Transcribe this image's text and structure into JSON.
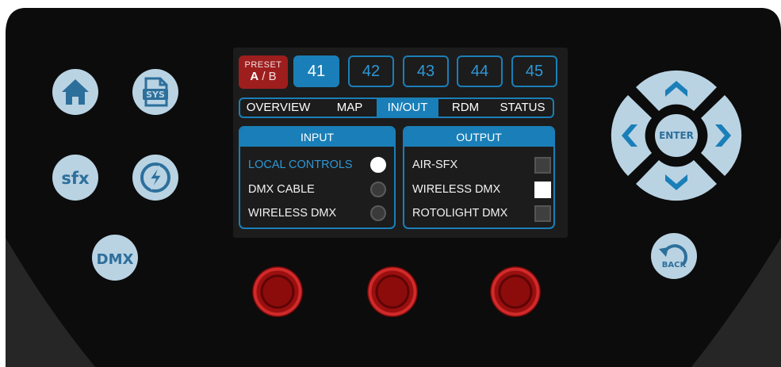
{
  "preset": {
    "title": "PRESET",
    "a": "A",
    "sep": " / ",
    "b": "B"
  },
  "preset_numbers": [
    "41",
    "42",
    "43",
    "44",
    "45"
  ],
  "active_preset": "41",
  "tabs": [
    "OVERVIEW",
    "MAP",
    "IN/OUT",
    "RDM",
    "STATUS"
  ],
  "active_tab": "IN/OUT",
  "input": {
    "header": "INPUT",
    "items": [
      "LOCAL CONTROLS",
      "DMX CABLE",
      "WIRELESS DMX"
    ],
    "selected": "LOCAL CONTROLS"
  },
  "output": {
    "header": "OUTPUT",
    "items": [
      "AIR-SFX",
      "WIRELESS DMX",
      "ROTOLIGHT DMX"
    ],
    "checked": [
      "WIRELESS DMX"
    ]
  },
  "buttons": {
    "home_icon": "home-icon",
    "sys_label": "SYS",
    "sfx_label": "sfx",
    "power_icon": "lightning-icon",
    "dmx_label": "DMX",
    "enter_label": "ENTER",
    "back_label": "BACK"
  },
  "colors": {
    "accent": "#1a7fb8",
    "highlight": "#2f97d6",
    "preset_red": "#9e1e1e",
    "button_bg": "#b9d3e3",
    "knob_red": "#c21c1c",
    "body": "#0c0c0c"
  }
}
